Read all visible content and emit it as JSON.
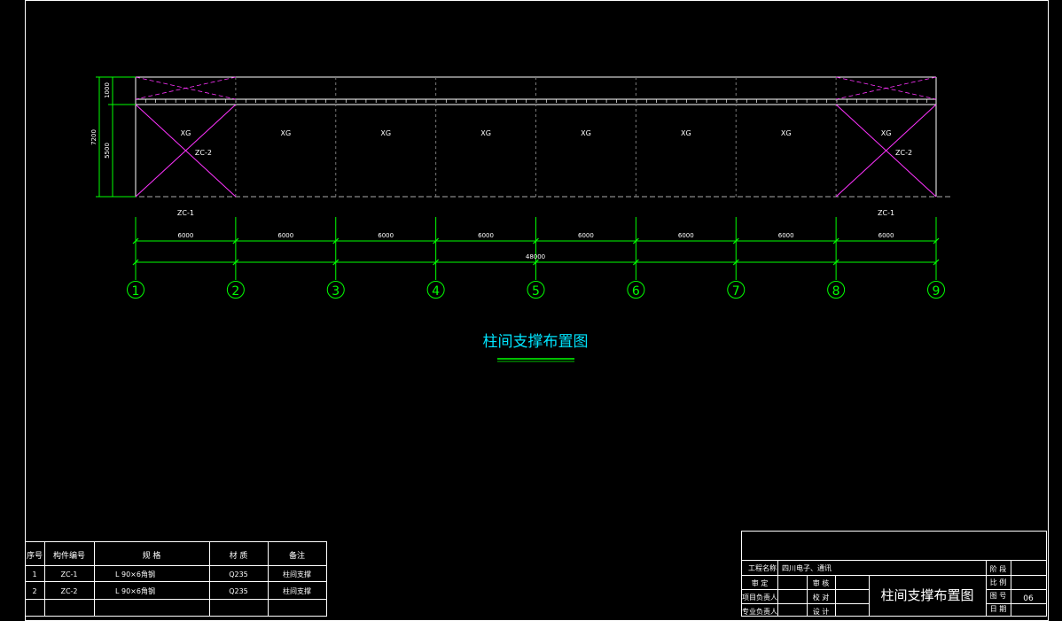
{
  "drawing": {
    "title": "柱间支撑布置图",
    "bays": [
      {
        "label": "XG",
        "brace": "ZC-2",
        "bottom": "ZC-1"
      },
      {
        "label": "XG",
        "brace": "",
        "bottom": ""
      },
      {
        "label": "XG",
        "brace": "",
        "bottom": ""
      },
      {
        "label": "XG",
        "brace": "",
        "bottom": ""
      },
      {
        "label": "XG",
        "brace": "",
        "bottom": ""
      },
      {
        "label": "XG",
        "brace": "",
        "bottom": ""
      },
      {
        "label": "XG",
        "brace": "",
        "bottom": ""
      },
      {
        "label": "XG",
        "brace": "ZC-2",
        "bottom": "ZC-1"
      }
    ],
    "bay_dims": [
      "6000",
      "6000",
      "6000",
      "6000",
      "6000",
      "6000",
      "6000",
      "6000"
    ],
    "total_dim": "48000",
    "axes": [
      "1",
      "2",
      "3",
      "4",
      "5",
      "6",
      "7",
      "8",
      "9"
    ],
    "vertical_dims": {
      "top": "1000",
      "middle": "5500",
      "overall": "7200"
    },
    "colors": {
      "brace": "#ff33ff",
      "grid": "#00ff00",
      "dimension": "#00ff00",
      "title": "#00e5ff",
      "line": "#ffffff"
    }
  },
  "member_table": {
    "headers": [
      "序号",
      "构件编号",
      "规 格",
      "材 质",
      "备注"
    ],
    "rows": [
      [
        "1",
        "ZC-1",
        "L 90×6角钢",
        "Q235",
        "柱间支撑"
      ],
      [
        "2",
        "ZC-2",
        "L 90×6角钢",
        "Q235",
        "柱间支撑"
      ]
    ]
  },
  "title_block": {
    "project_label": "工程名称",
    "project_name": "四川电子、通讯",
    "title": "柱间支撑布置图",
    "roles": [
      "审 定",
      "项目负责人",
      "专业负责人"
    ],
    "checks": [
      "审 核",
      "校 对",
      "设 计"
    ],
    "info_labels": [
      "阶 段",
      "比 例",
      "图 号",
      "日 期"
    ],
    "drawing_no": "06"
  }
}
